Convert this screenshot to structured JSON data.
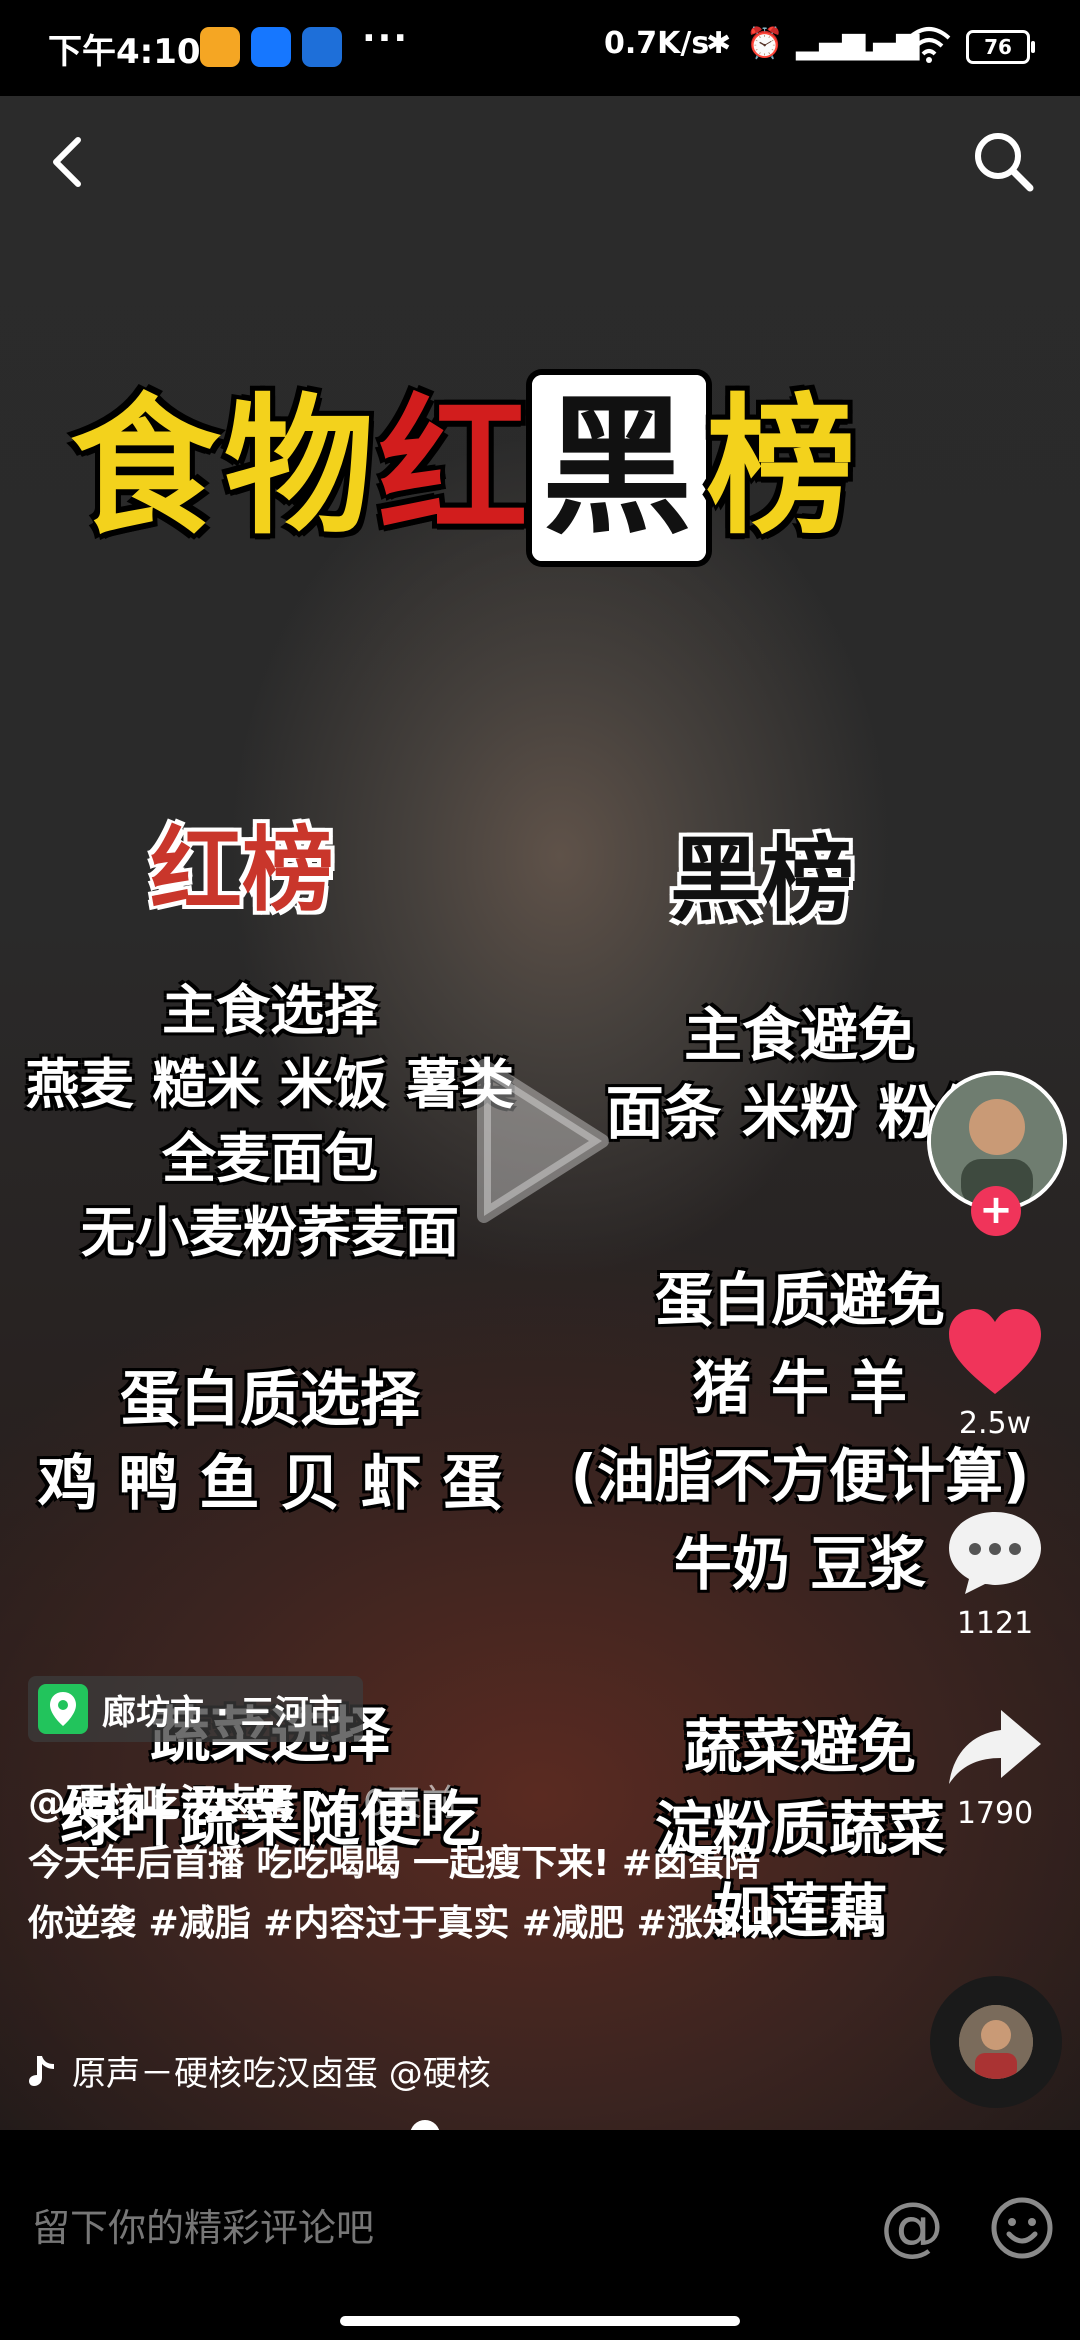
{
  "status_bar": {
    "time": "下午4:10",
    "network_speed": "0.7K/s",
    "battery": "76"
  },
  "video": {
    "title_parts": [
      "食物",
      "红",
      "黑",
      "榜"
    ],
    "red_list": {
      "heading": "红榜",
      "staple": [
        "主食选择",
        "燕麦 糙米 米饭 薯类",
        "全麦面包",
        "无小麦粉荞麦面"
      ],
      "protein": [
        "蛋白质选择",
        "鸡 鸭 鱼 贝 虾 蛋"
      ],
      "veg": [
        "蔬菜选择",
        "绿叶蔬菜随便吃"
      ]
    },
    "black_list": {
      "heading": "黑榜",
      "staple": [
        "主食避免",
        "面条 米粉 粉丝"
      ],
      "protein": [
        "蛋白质避免",
        "猪 牛 羊",
        "(油脂不方便计算)",
        "牛奶 豆浆"
      ],
      "veg": [
        "蔬菜避免",
        "淀粉质蔬菜",
        "如莲藕"
      ]
    },
    "progress": 0.39
  },
  "rail": {
    "likes": "2.5w",
    "comments": "1121",
    "shares": "1790",
    "follow_symbol": "+"
  },
  "post": {
    "location": "廊坊市 · 三河市",
    "author": "@硬核吃汉卤蛋",
    "time_ago": "· 6天前",
    "description": "今天年后首播 吃吃喝喝 一起瘦下来! #卤蛋陪你逆袭 #减脂 #内容过于真实 #减肥 #涨知识",
    "music": "原声－硬核吃汉卤蛋  @硬核"
  },
  "comment_bar": {
    "placeholder": "留下你的精彩评论吧",
    "at_symbol": "@"
  },
  "colors": {
    "title_yellow": "#f3d21c",
    "title_red": "#d21d1d",
    "like_red": "#f0345a",
    "location_green": "#22c45c"
  }
}
